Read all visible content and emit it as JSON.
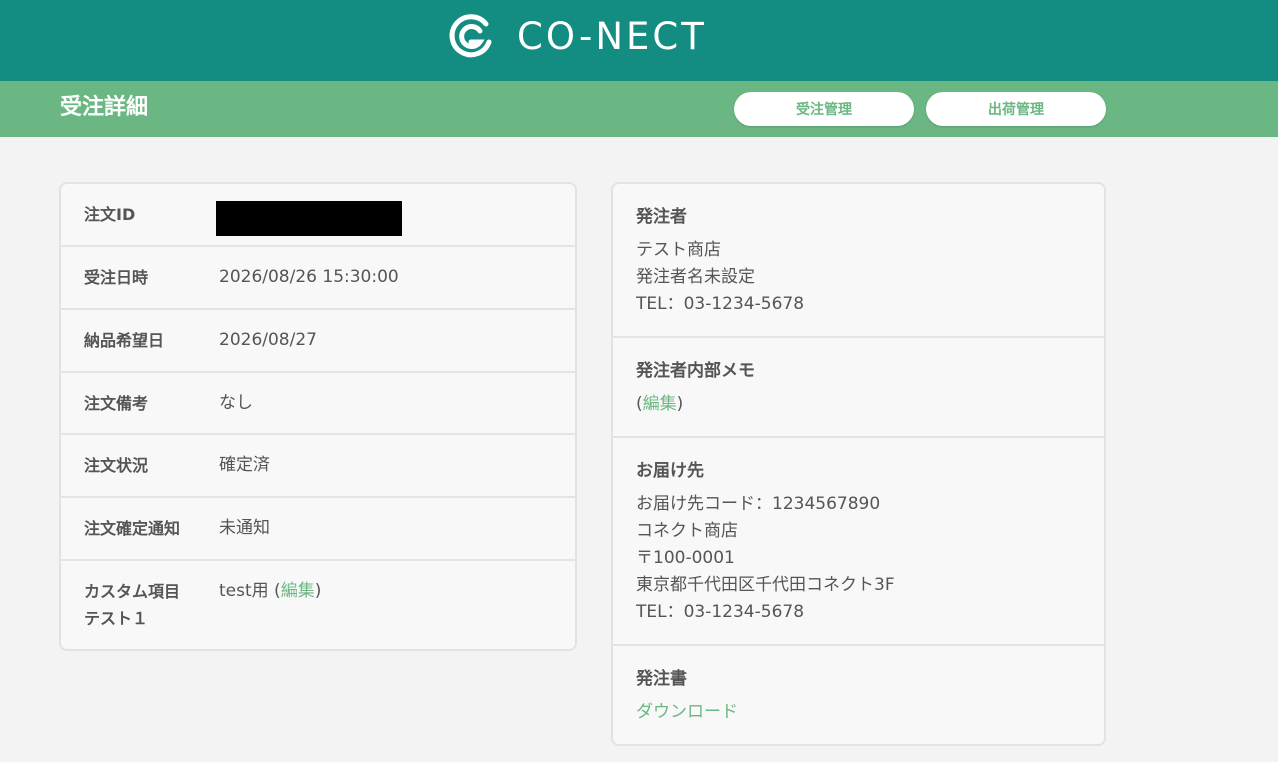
{
  "header": {
    "logo_text": "CO-NECT",
    "brand_color": "#138d82",
    "subbar_color": "#6bb783"
  },
  "subheader": {
    "title": "受注詳細",
    "nav": [
      "受注管理",
      "出荷管理"
    ]
  },
  "order": {
    "rows": [
      {
        "label": "注文ID",
        "value": ""
      },
      {
        "label": "受注日時",
        "value": "2026/08/26 15:30:00"
      },
      {
        "label": "納品希望日",
        "value": "2026/08/27"
      },
      {
        "label": "注文備考",
        "value": "なし"
      },
      {
        "label": "注文状況",
        "value": "確定済"
      },
      {
        "label": "注文確定通知",
        "value": "未通知"
      },
      {
        "label": "カスタム項目テスト１",
        "label_line1": "カスタム項目",
        "label_line2": "テスト１",
        "value": "test用",
        "link": "編集"
      }
    ]
  },
  "orderer": {
    "heading": "発注者",
    "lines": [
      "テスト商店",
      "発注者名未設定",
      "TEL：03-1234-5678"
    ]
  },
  "memo": {
    "heading": "発注者内部メモ",
    "link": "編集"
  },
  "delivery": {
    "heading": "お届け先",
    "lines": [
      "お届け先コード：1234567890",
      "コネクト商店",
      "〒100-0001",
      "東京都千代田区千代田コネクト3F",
      "TEL：03-1234-5678"
    ]
  },
  "po": {
    "heading": "発注書",
    "link": "ダウンロード"
  }
}
